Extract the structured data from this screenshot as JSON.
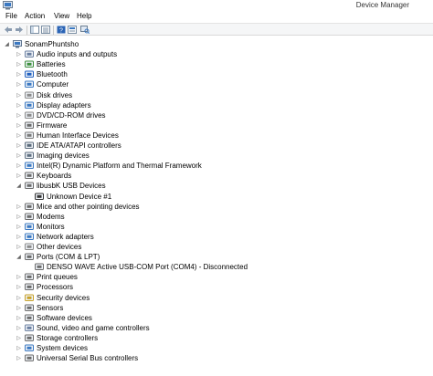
{
  "window": {
    "title": "Device Manager"
  },
  "menu": [
    "File",
    "Action",
    "View",
    "Help"
  ],
  "tree": {
    "root": "SonamPhuntsho",
    "categories": [
      {
        "label": "Audio inputs and outputs",
        "icon": "speaker-icon",
        "color": "#6a7fa0"
      },
      {
        "label": "Batteries",
        "icon": "battery-icon",
        "color": "#3c8f3c"
      },
      {
        "label": "Bluetooth",
        "icon": "bluetooth-icon",
        "color": "#1f5fbf"
      },
      {
        "label": "Computer",
        "icon": "computer-icon",
        "color": "#3a78c2"
      },
      {
        "label": "Disk drives",
        "icon": "disk-icon",
        "color": "#8a8a8a"
      },
      {
        "label": "Display adapters",
        "icon": "monitor-icon",
        "color": "#3a78c2"
      },
      {
        "label": "DVD/CD-ROM drives",
        "icon": "dvd-icon",
        "color": "#8a8a8a"
      },
      {
        "label": "Firmware",
        "icon": "chip-icon",
        "color": "#6b6b6b"
      },
      {
        "label": "Human Interface Devices",
        "icon": "hid-icon",
        "color": "#7a7a7a"
      },
      {
        "label": "IDE ATA/ATAPI controllers",
        "icon": "controller-icon",
        "color": "#5a6a7a"
      },
      {
        "label": "Imaging devices",
        "icon": "camera-icon",
        "color": "#5f6f80"
      },
      {
        "label": "Intel(R) Dynamic Platform and Thermal Framework",
        "icon": "chip-icon",
        "color": "#3a78c2"
      },
      {
        "label": "Keyboards",
        "icon": "keyboard-icon",
        "color": "#6b6b6b"
      },
      {
        "label": "libusbK USB Devices",
        "icon": "usb-icon",
        "color": "#6b6b6b",
        "expanded": true,
        "children": [
          {
            "label": "Unknown Device #1",
            "icon": "usb-plug-icon",
            "color": "#333333"
          }
        ]
      },
      {
        "label": "Mice and other pointing devices",
        "icon": "mouse-icon",
        "color": "#6b6b6b"
      },
      {
        "label": "Modems",
        "icon": "modem-icon",
        "color": "#6b6b6b"
      },
      {
        "label": "Monitors",
        "icon": "monitor-icon",
        "color": "#3a78c2"
      },
      {
        "label": "Network adapters",
        "icon": "network-icon",
        "color": "#3a78c2"
      },
      {
        "label": "Other devices",
        "icon": "other-devices-icon",
        "color": "#8a8a8a"
      },
      {
        "label": "Ports (COM & LPT)",
        "icon": "port-icon",
        "color": "#6b6b6b",
        "expanded": true,
        "children": [
          {
            "label": "DENSO WAVE Active USB-COM Port (COM4) - Disconnected",
            "icon": "port-icon",
            "color": "#6b6b6b"
          }
        ]
      },
      {
        "label": "Print queues",
        "icon": "printer-icon",
        "color": "#6b6b6b"
      },
      {
        "label": "Processors",
        "icon": "processor-icon",
        "color": "#6b6b6b"
      },
      {
        "label": "Security devices",
        "icon": "security-icon",
        "color": "#c9a227"
      },
      {
        "label": "Sensors",
        "icon": "sensor-icon",
        "color": "#6b6b6b"
      },
      {
        "label": "Software devices",
        "icon": "software-icon",
        "color": "#6b6b6b"
      },
      {
        "label": "Sound, video and game controllers",
        "icon": "speaker-icon",
        "color": "#6a7fa0"
      },
      {
        "label": "Storage controllers",
        "icon": "storage-icon",
        "color": "#6b6b6b"
      },
      {
        "label": "System devices",
        "icon": "system-icon",
        "color": "#3a78c2"
      },
      {
        "label": "Universal Serial Bus controllers",
        "icon": "usb-icon",
        "color": "#6b6b6b"
      }
    ]
  }
}
